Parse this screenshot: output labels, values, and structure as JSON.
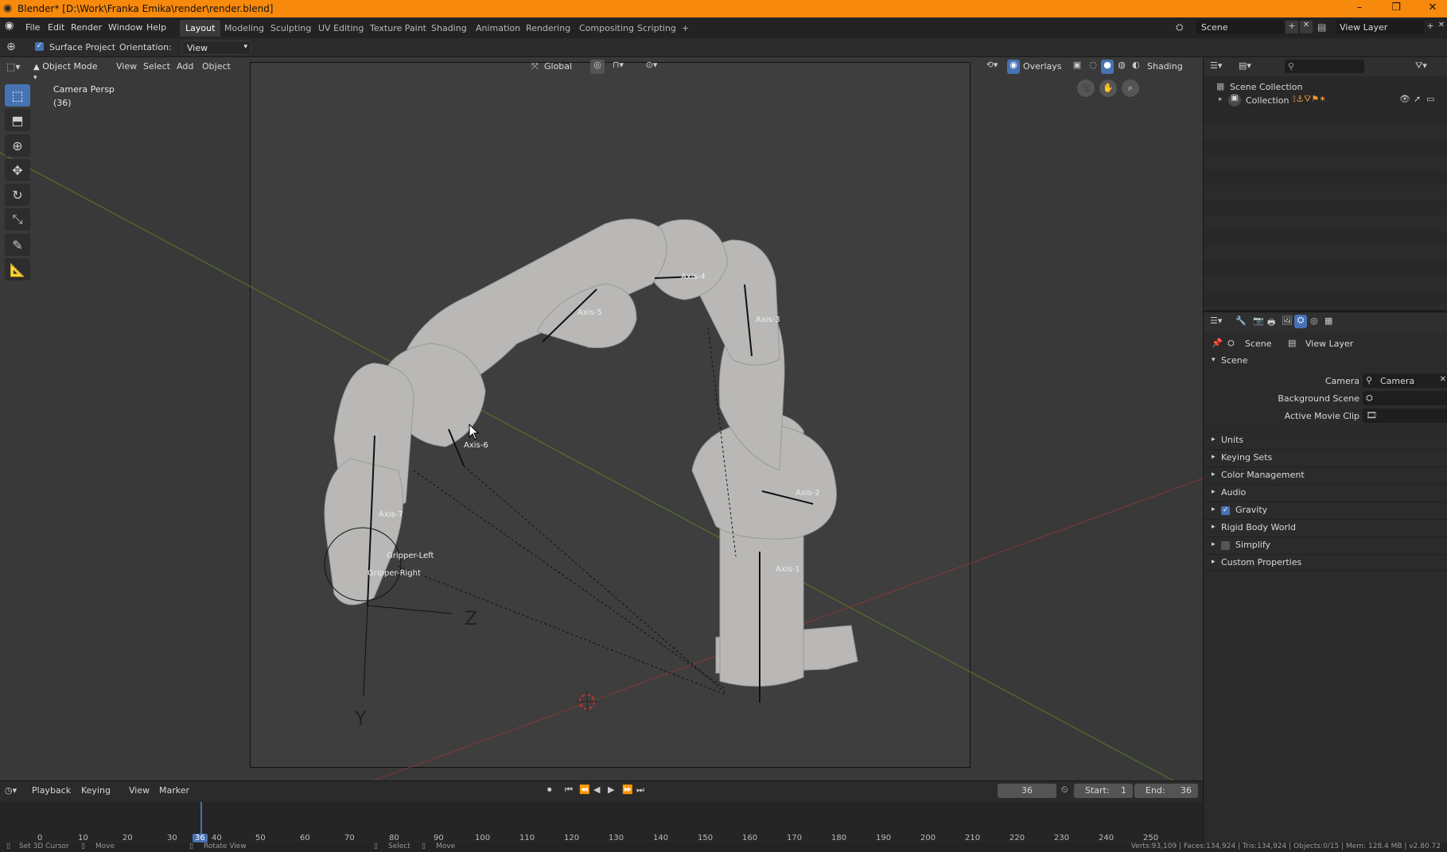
{
  "window": {
    "title": "Blender* [D:\\Work\\Franka Emika\\render\\render.blend]",
    "minimize": "–",
    "restore": "❐",
    "close": "✕"
  },
  "menu": [
    "File",
    "Edit",
    "Render",
    "Window",
    "Help"
  ],
  "workspace_tabs": [
    {
      "label": "Layout",
      "active": true
    },
    {
      "label": "Modeling"
    },
    {
      "label": "Sculpting"
    },
    {
      "label": "UV Editing"
    },
    {
      "label": "Texture Paint"
    },
    {
      "label": "Shading"
    },
    {
      "label": "Animation"
    },
    {
      "label": "Rendering"
    },
    {
      "label": "Compositing"
    },
    {
      "label": "Scripting"
    }
  ],
  "add_workspace": "+",
  "scene_selector": {
    "value": "Scene"
  },
  "view_layer_selector": {
    "value": "View Layer"
  },
  "tool_header": {
    "surface_project": "Surface Project",
    "orientation_label": "Orientation:",
    "orientation_value": "View"
  },
  "viewport_header": {
    "mode": "Object Mode",
    "menus": [
      "View",
      "Select",
      "Add",
      "Object"
    ],
    "transform": "Global",
    "overlays": "Overlays",
    "shading": "Shading"
  },
  "viewport_info": {
    "line1": "Camera Persp",
    "line2": "(36)"
  },
  "armature_labels": {
    "axis1": "Axis-1",
    "axis2": "Axis-2",
    "axis3": "Axis-3",
    "axis4": "Axis-4",
    "axis5": "Axis-5",
    "axis6": "Axis-6",
    "axis7": "Axis-7",
    "gripper_left": "Gripper-Left",
    "gripper_right": "Gripper-Right",
    "axis_z": "Z",
    "axis_y": "Y"
  },
  "outliner": {
    "root": "Scene Collection",
    "collection": "Collection"
  },
  "properties": {
    "breadcrumb_scene": "Scene",
    "breadcrumb_view_layer": "View Layer",
    "section_scene": "Scene",
    "camera_label": "Camera",
    "camera_value": "Camera",
    "background_scene_label": "Background Scene",
    "active_movie_clip_label": "Active Movie Clip",
    "panels": [
      "Units",
      "Keying Sets",
      "Color Management",
      "Audio",
      "Gravity",
      "Rigid Body World",
      "Simplify",
      "Custom Properties"
    ]
  },
  "timeline": {
    "menus": [
      "Playback",
      "Keying",
      "View",
      "Marker"
    ],
    "current_frame": "36",
    "start_label": "Start:",
    "start_value": "1",
    "end_label": "End:",
    "end_value": "36",
    "ruler": [
      "0",
      "10",
      "20",
      "30",
      "36",
      "40",
      "50",
      "60",
      "70",
      "80",
      "90",
      "100",
      "110",
      "120",
      "130",
      "140",
      "150",
      "160",
      "170",
      "180",
      "190",
      "200",
      "210",
      "220",
      "230",
      "240",
      "250"
    ]
  },
  "statusbar": {
    "left1": "Set 3D Cursor",
    "left2": "Move",
    "left3": "Rotate View",
    "mid1": "Select",
    "mid2": "Move",
    "right": "Verts:93,109 | Faces:134,924 | Tris:134,924 | Objects:0/15 | Mem: 128.4 MB | v2.80.72"
  }
}
